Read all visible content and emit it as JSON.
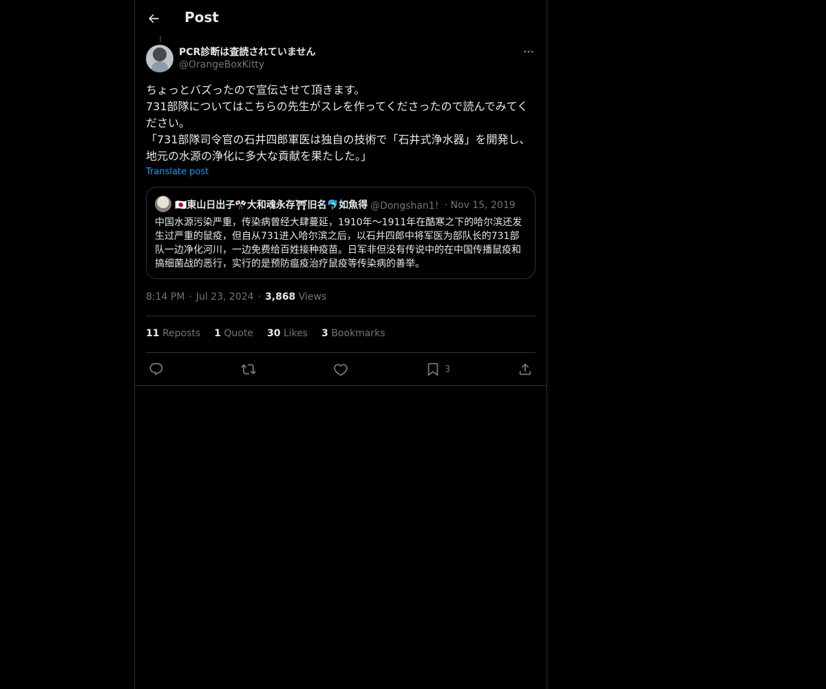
{
  "header": {
    "title": "Post",
    "back_icon": "arrow-left-icon"
  },
  "post": {
    "author_name": "PCR診断は査読されていません",
    "author_handle": "@OrangeBoxKitty",
    "text": "ちょっとバズったので宣伝させて頂きます。\n731部隊についてはこちらの先生がスレを作ってくださったので読んでみてください。\n「731部隊司令官の石井四郎軍医は独自の技術で「石井式浄水器」を開発し、地元の水源の浄化に多大な貢献を果たした。」",
    "translate_label": "Translate post",
    "quote": {
      "name": "🇯🇵東山日出子🎌大和魂永存⛩旧名🐬如魚得",
      "handle": "@Dongshan1!",
      "date": "Nov 15, 2019",
      "text": "中国水源污染严重，传染病曾经大肆蔓延，1910年〜1911年在酷寒之下的哈尔滨还发生过严重的鼠疫，但自从731进入哈尔滨之后，以石井四郎中将军医为部队长的731部队一边净化河川，一边免费给百姓接种疫苗。日军非但没有传说中的在中国传播鼠疫和搞细菌战的恶行，实行的是预防瘟疫治疗鼠疫等传染病的善举。"
    },
    "time": "8:14 PM",
    "date": "Jul 23, 2024",
    "views_count": "3,868",
    "views_label": "Views",
    "stats": [
      {
        "count": "11",
        "label": "Reposts"
      },
      {
        "count": "1",
        "label": "Quote"
      },
      {
        "count": "30",
        "label": "Likes"
      },
      {
        "count": "3",
        "label": "Bookmarks"
      }
    ],
    "actions": {
      "reply_icon": "reply-icon",
      "repost_icon": "repost-icon",
      "like_icon": "heart-icon",
      "bookmark_icon": "bookmark-icon",
      "bookmark_count": "3",
      "share_icon": "share-icon"
    }
  },
  "colors": {
    "background": "#000000",
    "text": "#e7e9ea",
    "secondary": "#71767b",
    "accent": "#1d9bf0",
    "border": "#2f3336"
  }
}
